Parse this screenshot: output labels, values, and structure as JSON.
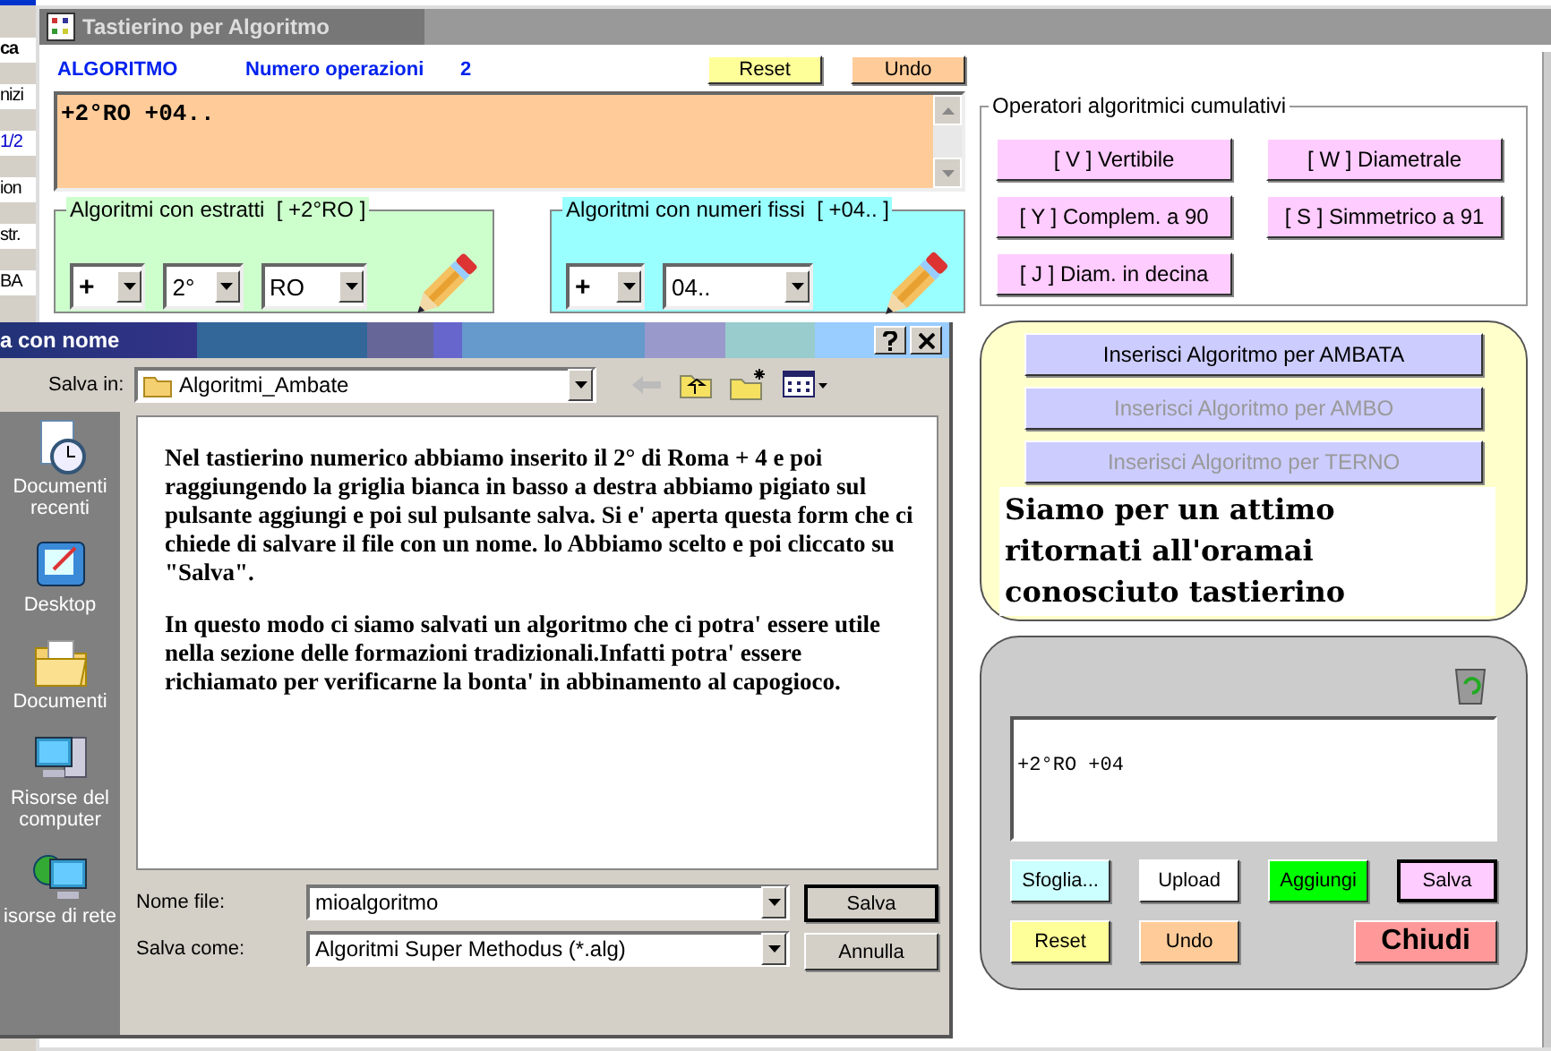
{
  "background_window": {
    "fragments": [
      "ca",
      "nizi",
      "1/2",
      "ion",
      "str.",
      "BA"
    ]
  },
  "window": {
    "title": "Tastierino per Algoritmo"
  },
  "header": {
    "label": "ALGORITMO",
    "count_label": "Numero operazioni",
    "count": "2"
  },
  "header_buttons": [
    {
      "label": "Reset",
      "color": "#ffff99"
    },
    {
      "label": "Undo",
      "color": "#ffcc99"
    }
  ],
  "algorithm_text": "+2°RO +04..",
  "groups": [
    {
      "title": "Algoritmi con estratti  [ +2°RO ]",
      "color": "#ccffcc",
      "combos": [
        "+",
        "2°",
        "RO"
      ]
    },
    {
      "title": "Algoritmi con numeri fissi  [ +04.. ]",
      "color": "#99ffff",
      "combos": [
        "+",
        "04.."
      ]
    }
  ],
  "operators": {
    "title": "Operatori algoritmici cumulativi",
    "buttons": [
      "[ V ] Vertibile",
      "[ W ] Diametrale",
      "[ Y ] Complem. a 90",
      "[ S ] Simmetrico  a 91",
      "[ J ] Diam. in decina"
    ]
  },
  "insert_buttons": [
    {
      "label": "Inserisci Algoritmo per AMBATA",
      "disabled": false
    },
    {
      "label": "Inserisci Algoritmo per AMBO",
      "disabled": true
    },
    {
      "label": "Inserisci Algoritmo per TERNO",
      "disabled": true
    }
  ],
  "note": "Siamo per un attimo ritornati all'oramai conosciuto tastierino",
  "list_panel": {
    "text": "+2°RO +04",
    "buttons": [
      {
        "label": "Sfoglia...",
        "color": "#ccffff",
        "default": false
      },
      {
        "label": "Upload",
        "color": "#ffffff",
        "default": false
      },
      {
        "label": "Aggiungi",
        "color": "#00ff00",
        "default": false
      },
      {
        "label": "Salva",
        "color": "#ffccff",
        "default": true
      }
    ],
    "bottom_buttons": [
      {
        "label": "Reset",
        "color": "#ffff99"
      },
      {
        "label": "Undo",
        "color": "#ffcc99"
      }
    ],
    "close_button": {
      "label": "Chiudi",
      "color": "#ff9999"
    }
  },
  "dialog": {
    "title": "a con nome",
    "save_in_label": "Salva in:",
    "folder": "Algoritmi_Ambate",
    "places": [
      {
        "kind": "recent",
        "label": "Documenti recenti"
      },
      {
        "kind": "desktop",
        "label": "Desktop"
      },
      {
        "kind": "documents",
        "label": "Documenti"
      },
      {
        "kind": "computer",
        "label": "Risorse del computer"
      },
      {
        "kind": "network",
        "label": "isorse di rete"
      }
    ],
    "message": [
      "Nel tastierino numerico abbiamo inserito il 2° di Roma + 4 e poi raggiungendo la griglia bianca in basso a destra abbiamo pigiato sul pulsante aggiungi e poi sul pulsante salva. Si e' aperta questa form che ci chiede di salvare il file con un nome. lo Abbiamo scelto e poi cliccato su \"Salva\".",
      "In questo modo ci siamo salvati un algoritmo che ci potra' essere utile nella sezione delle formazioni tradizionali.Infatti potra' essere richiamato per verificarne la bonta' in abbinamento al capogioco."
    ],
    "fields": [
      {
        "label": "Nome file:",
        "value": "mioalgoritmo"
      },
      {
        "label": "Salva come:",
        "value": "Algoritmi Super Methodus (*.alg)"
      }
    ],
    "buttons": [
      {
        "label": "Salva",
        "default": true
      },
      {
        "label": "Annulla",
        "default": false
      }
    ]
  }
}
